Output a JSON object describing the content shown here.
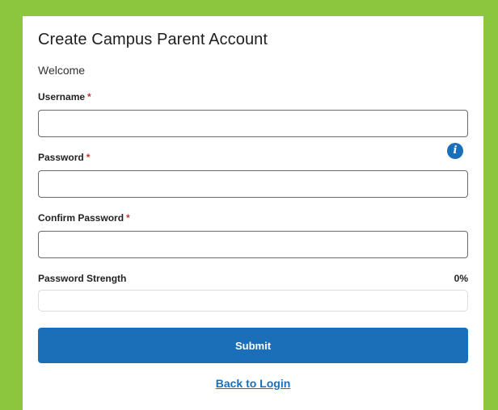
{
  "form": {
    "title": "Create Campus Parent Account",
    "welcome": "Welcome",
    "required_marker": "*",
    "username": {
      "label": "Username",
      "value": "",
      "placeholder": ""
    },
    "password": {
      "label": "Password",
      "value": "",
      "placeholder": "",
      "info_icon": "i"
    },
    "confirm_password": {
      "label": "Confirm Password",
      "value": "",
      "placeholder": ""
    },
    "strength": {
      "label": "Password Strength",
      "value_text": "0%",
      "percent": 0
    },
    "submit_label": "Submit",
    "back_link_label": "Back to Login"
  },
  "colors": {
    "background": "#8cc63f",
    "accent": "#1a6fb8",
    "required": "#c0392b"
  }
}
